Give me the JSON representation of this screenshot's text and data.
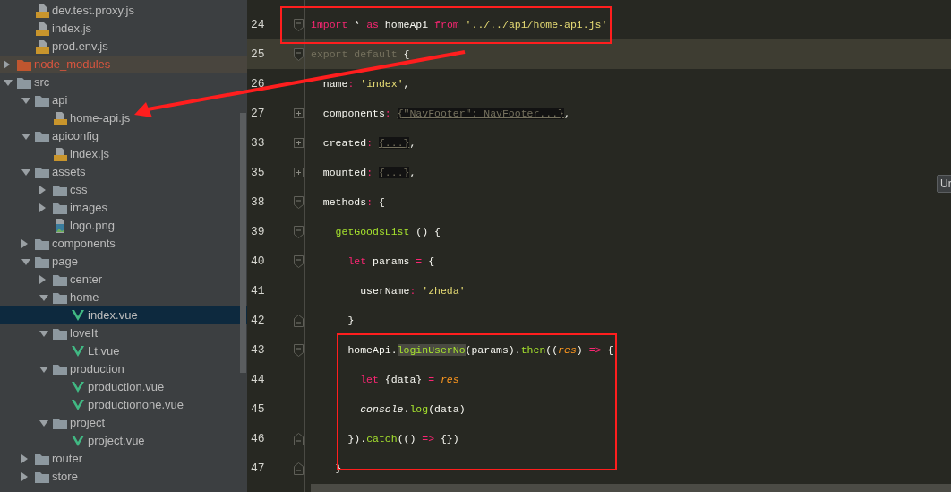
{
  "project_tree": {
    "partial_group": [
      {
        "label": "dev.test.proxy.js",
        "kind": "js",
        "selected": false,
        "excluded": false
      },
      {
        "label": "index.js",
        "kind": "js",
        "selected": false,
        "excluded": false
      },
      {
        "label": "prod.env.js",
        "kind": "js",
        "selected": false,
        "excluded": false
      }
    ],
    "items": [
      {
        "label": "node_modules",
        "kind": "folder",
        "expanded": false,
        "selected": false,
        "excluded": true
      },
      {
        "label": "src",
        "kind": "folder",
        "expanded": true,
        "selected": false,
        "excluded": false,
        "children": [
          {
            "label": "api",
            "kind": "folder",
            "expanded": true,
            "selected": false,
            "excluded": false,
            "children": [
              {
                "label": "home-api.js",
                "kind": "js",
                "selected": false,
                "excluded": false
              }
            ]
          },
          {
            "label": "apiconfig",
            "kind": "folder",
            "expanded": true,
            "selected": false,
            "excluded": false,
            "children": [
              {
                "label": "index.js",
                "kind": "js",
                "selected": false,
                "excluded": false
              }
            ]
          },
          {
            "label": "assets",
            "kind": "folder",
            "expanded": true,
            "selected": false,
            "excluded": false,
            "children": [
              {
                "label": "css",
                "kind": "folder",
                "expanded": false,
                "selected": false,
                "excluded": false
              },
              {
                "label": "images",
                "kind": "folder",
                "expanded": false,
                "selected": false,
                "excluded": false
              },
              {
                "label": "logo.png",
                "kind": "png",
                "selected": false,
                "excluded": false
              }
            ]
          },
          {
            "label": "components",
            "kind": "folder",
            "expanded": false,
            "selected": false,
            "excluded": false
          },
          {
            "label": "page",
            "kind": "folder",
            "expanded": true,
            "selected": false,
            "excluded": false,
            "children": [
              {
                "label": "center",
                "kind": "folder",
                "expanded": false,
                "selected": false,
                "excluded": false
              },
              {
                "label": "home",
                "kind": "folder",
                "expanded": true,
                "selected": false,
                "excluded": false,
                "children": [
                  {
                    "label": "index.vue",
                    "kind": "vue",
                    "selected": true,
                    "excluded": false
                  }
                ]
              },
              {
                "label": "loveIt",
                "kind": "folder",
                "expanded": true,
                "selected": false,
                "excluded": false,
                "children": [
                  {
                    "label": "Lt.vue",
                    "kind": "vue",
                    "selected": false,
                    "excluded": false
                  }
                ]
              },
              {
                "label": "production",
                "kind": "folder",
                "expanded": true,
                "selected": false,
                "excluded": false,
                "children": [
                  {
                    "label": "production.vue",
                    "kind": "vue",
                    "selected": false,
                    "excluded": false
                  },
                  {
                    "label": "productionone.vue",
                    "kind": "vue",
                    "selected": false,
                    "excluded": false
                  }
                ]
              },
              {
                "label": "project",
                "kind": "folder",
                "expanded": true,
                "selected": false,
                "excluded": false,
                "children": [
                  {
                    "label": "project.vue",
                    "kind": "vue",
                    "selected": false,
                    "excluded": false
                  }
                ]
              }
            ]
          },
          {
            "label": "router",
            "kind": "folder",
            "expanded": false,
            "selected": false,
            "excluded": false
          },
          {
            "label": "store",
            "kind": "folder",
            "expanded": false,
            "selected": false,
            "excluded": false
          }
        ]
      }
    ]
  },
  "editor": {
    "lines": [
      {
        "number": "24",
        "fold_open": true,
        "fold_end": false,
        "collapsed": false,
        "current": false,
        "tokens": [
          {
            "kind": "keyword",
            "text": "import"
          },
          {
            "kind": "plain",
            "text": " * "
          },
          {
            "kind": "keyword",
            "text": "as"
          },
          {
            "kind": "plain",
            "text": " homeApi "
          },
          {
            "kind": "keyword",
            "text": "from"
          },
          {
            "kind": "string",
            "text": " '../../api/home-api.js'"
          }
        ]
      },
      {
        "number": "25",
        "fold_open": true,
        "fold_end": false,
        "collapsed": false,
        "current": true,
        "tokens": [
          {
            "kind": "dim",
            "text": "export default"
          },
          {
            "kind": "plain",
            "text": " {"
          }
        ]
      },
      {
        "number": "26",
        "fold_open": false,
        "fold_end": false,
        "collapsed": false,
        "current": false,
        "tokens": [
          {
            "kind": "plain",
            "text": "  name"
          },
          {
            "kind": "keyword",
            "text": ": "
          },
          {
            "kind": "string",
            "text": "'index'"
          },
          {
            "kind": "plain",
            "text": ","
          }
        ]
      },
      {
        "number": "27",
        "fold_open": false,
        "fold_end": false,
        "collapsed": true,
        "current": false,
        "tokens": [
          {
            "kind": "plain",
            "text": "  components"
          },
          {
            "kind": "keyword",
            "text": ": "
          },
          {
            "kind": "folded",
            "text": "{\"NavFooter\": NavFooter...}"
          },
          {
            "kind": "plain",
            "text": ","
          }
        ]
      },
      {
        "number": "33",
        "fold_open": false,
        "fold_end": false,
        "collapsed": true,
        "current": false,
        "tokens": [
          {
            "kind": "plain",
            "text": "  created"
          },
          {
            "kind": "keyword",
            "text": ": "
          },
          {
            "kind": "folded",
            "text": "{...}"
          },
          {
            "kind": "plain",
            "text": ","
          }
        ]
      },
      {
        "number": "35",
        "fold_open": false,
        "fold_end": false,
        "collapsed": true,
        "current": false,
        "tokens": [
          {
            "kind": "plain",
            "text": "  mounted"
          },
          {
            "kind": "keyword",
            "text": ": "
          },
          {
            "kind": "folded",
            "text": "{...}"
          },
          {
            "kind": "plain",
            "text": ","
          }
        ]
      },
      {
        "number": "38",
        "fold_open": true,
        "fold_end": false,
        "collapsed": false,
        "current": false,
        "tokens": [
          {
            "kind": "plain",
            "text": "  methods"
          },
          {
            "kind": "keyword",
            "text": ": "
          },
          {
            "kind": "plain",
            "text": "{"
          }
        ]
      },
      {
        "number": "39",
        "fold_open": true,
        "fold_end": false,
        "collapsed": false,
        "current": false,
        "tokens": [
          {
            "kind": "function",
            "text": "    getGoodsList"
          },
          {
            "kind": "plain",
            "text": " () {"
          }
        ]
      },
      {
        "number": "40",
        "fold_open": true,
        "fold_end": false,
        "collapsed": false,
        "current": false,
        "tokens": [
          {
            "kind": "keyword",
            "text": "      let"
          },
          {
            "kind": "plain",
            "text": " params "
          },
          {
            "kind": "keyword",
            "text": "="
          },
          {
            "kind": "plain",
            "text": " {"
          }
        ]
      },
      {
        "number": "41",
        "fold_open": false,
        "fold_end": false,
        "collapsed": false,
        "current": false,
        "tokens": [
          {
            "kind": "plain",
            "text": "        userName"
          },
          {
            "kind": "keyword",
            "text": ": "
          },
          {
            "kind": "string",
            "text": "'zheda'"
          }
        ]
      },
      {
        "number": "42",
        "fold_open": false,
        "fold_end": true,
        "collapsed": false,
        "current": false,
        "tokens": [
          {
            "kind": "plain",
            "text": "      }"
          }
        ]
      },
      {
        "number": "43",
        "fold_open": true,
        "fold_end": false,
        "collapsed": false,
        "current": false,
        "tokens": [
          {
            "kind": "plain",
            "text": "      homeApi."
          },
          {
            "kind": "match",
            "text": "loginUserNo"
          },
          {
            "kind": "plain",
            "text": "(params)."
          },
          {
            "kind": "function",
            "text": "then"
          },
          {
            "kind": "plain",
            "text": "(("
          },
          {
            "kind": "param",
            "text": "res"
          },
          {
            "kind": "plain",
            "text": ") "
          },
          {
            "kind": "keyword",
            "text": "=>"
          },
          {
            "kind": "plain",
            "text": " {"
          }
        ]
      },
      {
        "number": "44",
        "fold_open": false,
        "fold_end": false,
        "collapsed": false,
        "current": false,
        "tokens": [
          {
            "kind": "keyword",
            "text": "        let"
          },
          {
            "kind": "plain",
            "text": " {data} "
          },
          {
            "kind": "keyword",
            "text": "="
          },
          {
            "kind": "param",
            "text": " res"
          }
        ]
      },
      {
        "number": "45",
        "fold_open": false,
        "fold_end": false,
        "collapsed": false,
        "current": false,
        "tokens": [
          {
            "kind": "italic",
            "text": "        console"
          },
          {
            "kind": "plain",
            "text": "."
          },
          {
            "kind": "function",
            "text": "log"
          },
          {
            "kind": "plain",
            "text": "(data)"
          }
        ]
      },
      {
        "number": "46",
        "fold_open": false,
        "fold_end": true,
        "collapsed": false,
        "current": false,
        "tokens": [
          {
            "kind": "plain",
            "text": "      })."
          },
          {
            "kind": "function",
            "text": "catch"
          },
          {
            "kind": "plain",
            "text": "(() "
          },
          {
            "kind": "keyword",
            "text": "=>"
          },
          {
            "kind": "plain",
            "text": " {})"
          }
        ]
      },
      {
        "number": "47",
        "fold_open": false,
        "fold_end": true,
        "collapsed": false,
        "current": false,
        "tokens": [
          {
            "kind": "plain",
            "text": "    }"
          }
        ]
      }
    ]
  },
  "tooltip": {
    "text": "Ur"
  },
  "annotations": [
    {
      "kind": "box"
    },
    {
      "kind": "box"
    },
    {
      "kind": "arrow"
    }
  ]
}
